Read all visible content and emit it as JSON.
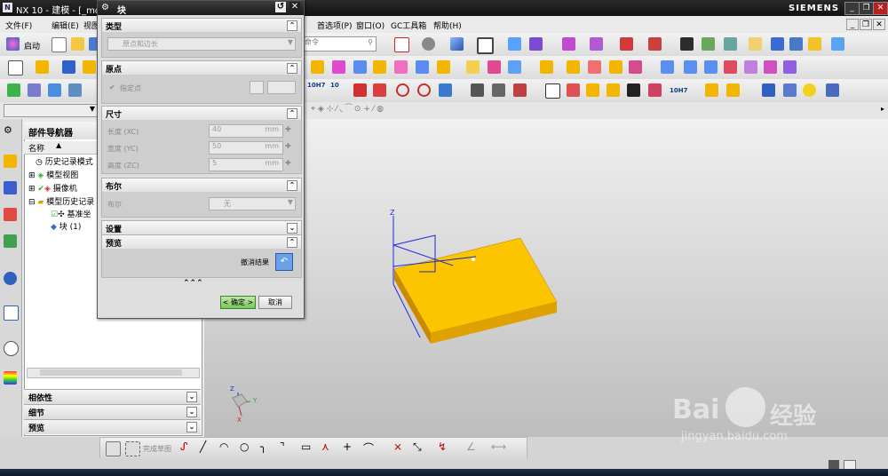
{
  "window": {
    "title": "NX 10 - 建模 - [_mode",
    "brand": "SIEMENS",
    "min": "_",
    "restore": "❐",
    "close": "✕"
  },
  "menubar": {
    "items": [
      "文件(F)",
      "编辑(E)",
      "视图",
      "首选项(P)",
      "窗口(O)",
      "GC工具箱",
      "帮助(H)"
    ],
    "start_label": "启动",
    "command_search_placeholder": "命令"
  },
  "toolbar3": {
    "std_label1": "10H7",
    "std_label2": "10",
    "std_label3": "10H7"
  },
  "navigator": {
    "title": "部件导航器",
    "column_name": "名称",
    "items": [
      {
        "label": "历史记录模式",
        "indent": 0
      },
      {
        "label": "模型视图",
        "indent": 0
      },
      {
        "label": "摄像机",
        "indent": 0
      },
      {
        "label": "模型历史记录",
        "indent": 0
      },
      {
        "label": "基准坐",
        "indent": 1
      },
      {
        "label": "块 (1)",
        "indent": 1
      }
    ],
    "sections": [
      "相依性",
      "细节",
      "预览"
    ]
  },
  "dialog": {
    "title": "块",
    "type_section": "类型",
    "type_value": "原点和边长",
    "origin_section": "原点",
    "specify_point": "指定点",
    "dims_section": "尺寸",
    "length_label": "长度 (XC)",
    "length_value": "40",
    "width_label": "宽度 (YC)",
    "width_value": "50",
    "height_label": "高度 (ZC)",
    "height_value": "5",
    "unit": "mm",
    "bool_section": "布尔",
    "bool_label": "布尔",
    "bool_value": "无",
    "settings_section": "设置",
    "preview_section": "预览",
    "undo_label": "撤消结果",
    "ok": "< 确定 >",
    "cancel": "取消"
  },
  "sketch_toolbar": {
    "finish_label": "完成草图"
  },
  "axes": {
    "z": "Z",
    "y": "Y",
    "x": "X"
  },
  "watermark": {
    "brand": "Bai",
    "brand2": "经验",
    "url": "jingyan.baidu.com"
  },
  "colors": {
    "block_top": "#fdc500",
    "block_side": "#e0a200",
    "block_front": "#c98a00",
    "axis_blue": "#1c2bd6",
    "title_dark": "#1a1a1a"
  }
}
